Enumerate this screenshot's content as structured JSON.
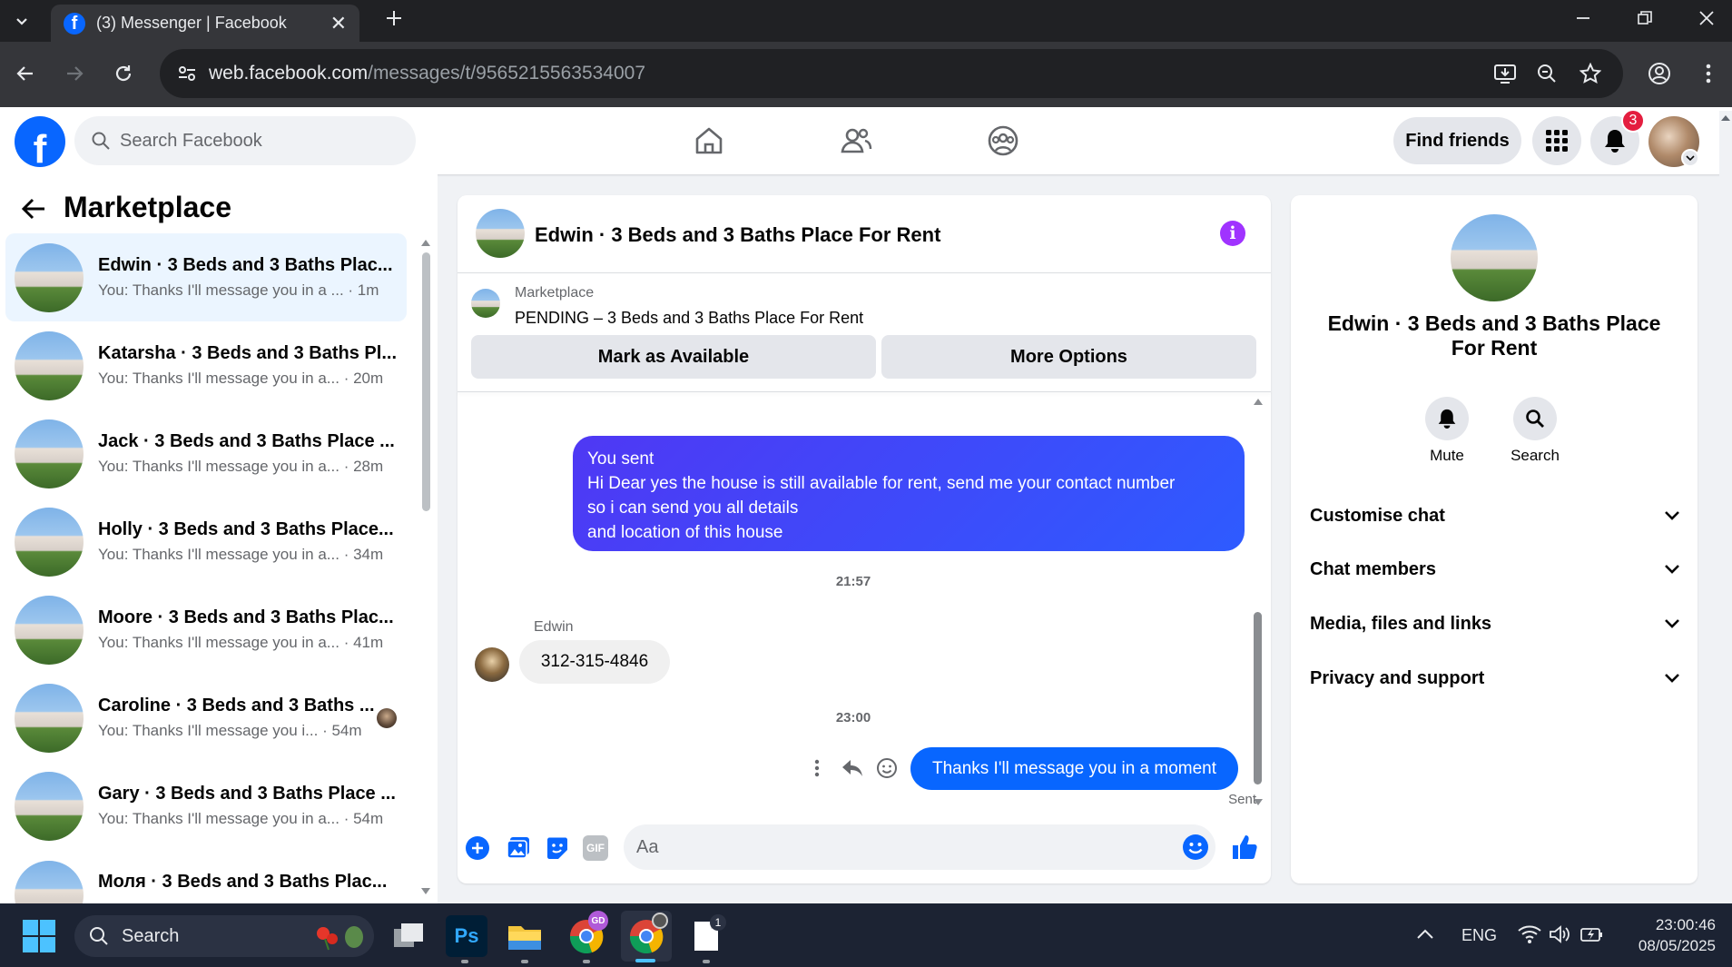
{
  "browser": {
    "tab_title": "(3) Messenger | Facebook",
    "url_host": "web.facebook.com",
    "url_path": "/messages/t/9565215563534007"
  },
  "header": {
    "search_placeholder": "Search Facebook",
    "find_friends": "Find friends",
    "notification_count": "3"
  },
  "sidebar": {
    "title": "Marketplace",
    "conversations": [
      {
        "name": "Edwin · 3 Beds and 3 Baths Plac...",
        "preview": "You: Thanks I'll message you in a ...",
        "time": "· 1m"
      },
      {
        "name": "Katarsha · 3 Beds and 3 Baths Pl...",
        "preview": "You: Thanks I'll message you in a...",
        "time": "· 20m"
      },
      {
        "name": "Jack · 3 Beds and 3 Baths Place ...",
        "preview": "You: Thanks I'll message you in a...",
        "time": "· 28m"
      },
      {
        "name": "Holly · 3 Beds and 3 Baths Place...",
        "preview": "You: Thanks I'll message you in a...",
        "time": "· 34m"
      },
      {
        "name": "Moore · 3 Beds and 3 Baths Plac...",
        "preview": "You: Thanks I'll message you in a...",
        "time": "· 41m"
      },
      {
        "name": "Caroline · 3 Beds and 3 Baths ...",
        "preview": "You: Thanks I'll message you i...",
        "time": "· 54m"
      },
      {
        "name": "Gary · 3 Beds and 3 Baths Place ...",
        "preview": "You: Thanks I'll message you in a...",
        "time": "· 54m"
      },
      {
        "name": "Моля · 3 Beds and 3 Baths Plac...",
        "preview": "",
        "time": ""
      }
    ]
  },
  "chat": {
    "title": "Edwin · 3 Beds and 3 Baths Place For Rent",
    "listing_source": "Marketplace",
    "listing_status": "PENDING – 3 Beds and 3 Baths Place For Rent",
    "mark_available": "Mark as Available",
    "more_options": "More Options",
    "messages": {
      "sent1_label": "You sent",
      "sent1_line1": "Hi Dear yes the house is still available for rent, send me your contact number",
      "sent1_line2": "so i can send you all details",
      "sent1_line3": "and location of this house",
      "time1": "21:57",
      "sender": "Edwin",
      "received": "312-315-4846",
      "time2": "23:00",
      "sent2": "Thanks I'll message you in a moment",
      "sent2_status": "Sent"
    },
    "composer_placeholder": "Aa"
  },
  "info": {
    "name_line1": "Edwin · 3 Beds and 3 Baths Place",
    "name_line2": "For Rent",
    "mute": "Mute",
    "search": "Search",
    "sections": [
      "Customise chat",
      "Chat members",
      "Media, files and links",
      "Privacy and support"
    ]
  },
  "taskbar": {
    "search": "Search",
    "lang": "ENG",
    "time": "23:00:46",
    "date": "08/05/2025"
  },
  "colors": {
    "fb_blue": "#0866ff",
    "accent_purple": "#a033ff",
    "bubble_gradient_start": "#4f38f4",
    "bubble_gradient_end": "#2e5bff"
  }
}
